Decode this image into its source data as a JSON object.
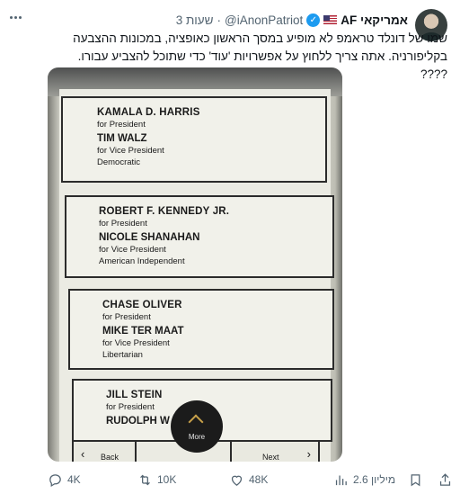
{
  "author": {
    "display_name": "AF אמריקאי",
    "handle": "@iAnonPatriot",
    "separator": "·",
    "time": "3 שעות"
  },
  "tweet_text": "שמו של דונלד טראמפ לא מופיע במסך הראשון כאופציה, במכונות ההצבעה בקליפורניה. אתה צריך ללחוץ על אפשרויות 'עוד' כדי שתוכל להצביע עבורו. ????",
  "ballot": {
    "candidates": [
      {
        "president": "KAMALA D. HARRIS",
        "president_role": "for President",
        "vice_president": "TIM WALZ",
        "vice_role": "for Vice President",
        "party": "Democratic"
      },
      {
        "president": "ROBERT F. KENNEDY JR.",
        "president_role": "for President",
        "vice_president": "NICOLE SHANAHAN",
        "vice_role": "for Vice President",
        "party": "American Independent"
      },
      {
        "president": "CHASE OLIVER",
        "president_role": "for President",
        "vice_president": "MIKE TER MAAT",
        "vice_role": "for Vice President",
        "party": "Libertarian"
      },
      {
        "president": "JILL STEIN",
        "president_role": "for President",
        "vice_president": "RUDOLPH W",
        "vice_role": "",
        "party": ""
      }
    ],
    "more_label": "More",
    "back_label": "Back",
    "next_label": "Next",
    "back_arrow": "‹",
    "next_arrow": "›"
  },
  "actions": {
    "replies": "4K",
    "retweets": "10K",
    "likes": "48K",
    "views": "2.6 מיליון"
  },
  "icons": {
    "more": "more-dots-icon",
    "verified": "verified-badge-icon",
    "reply": "reply-icon",
    "retweet": "retweet-icon",
    "like": "heart-icon",
    "views": "views-chart-icon",
    "bookmark": "bookmark-icon",
    "share": "share-icon"
  },
  "colors": {
    "text": "#0f1419",
    "secondary": "#536471",
    "verified": "#1d9bf0"
  }
}
